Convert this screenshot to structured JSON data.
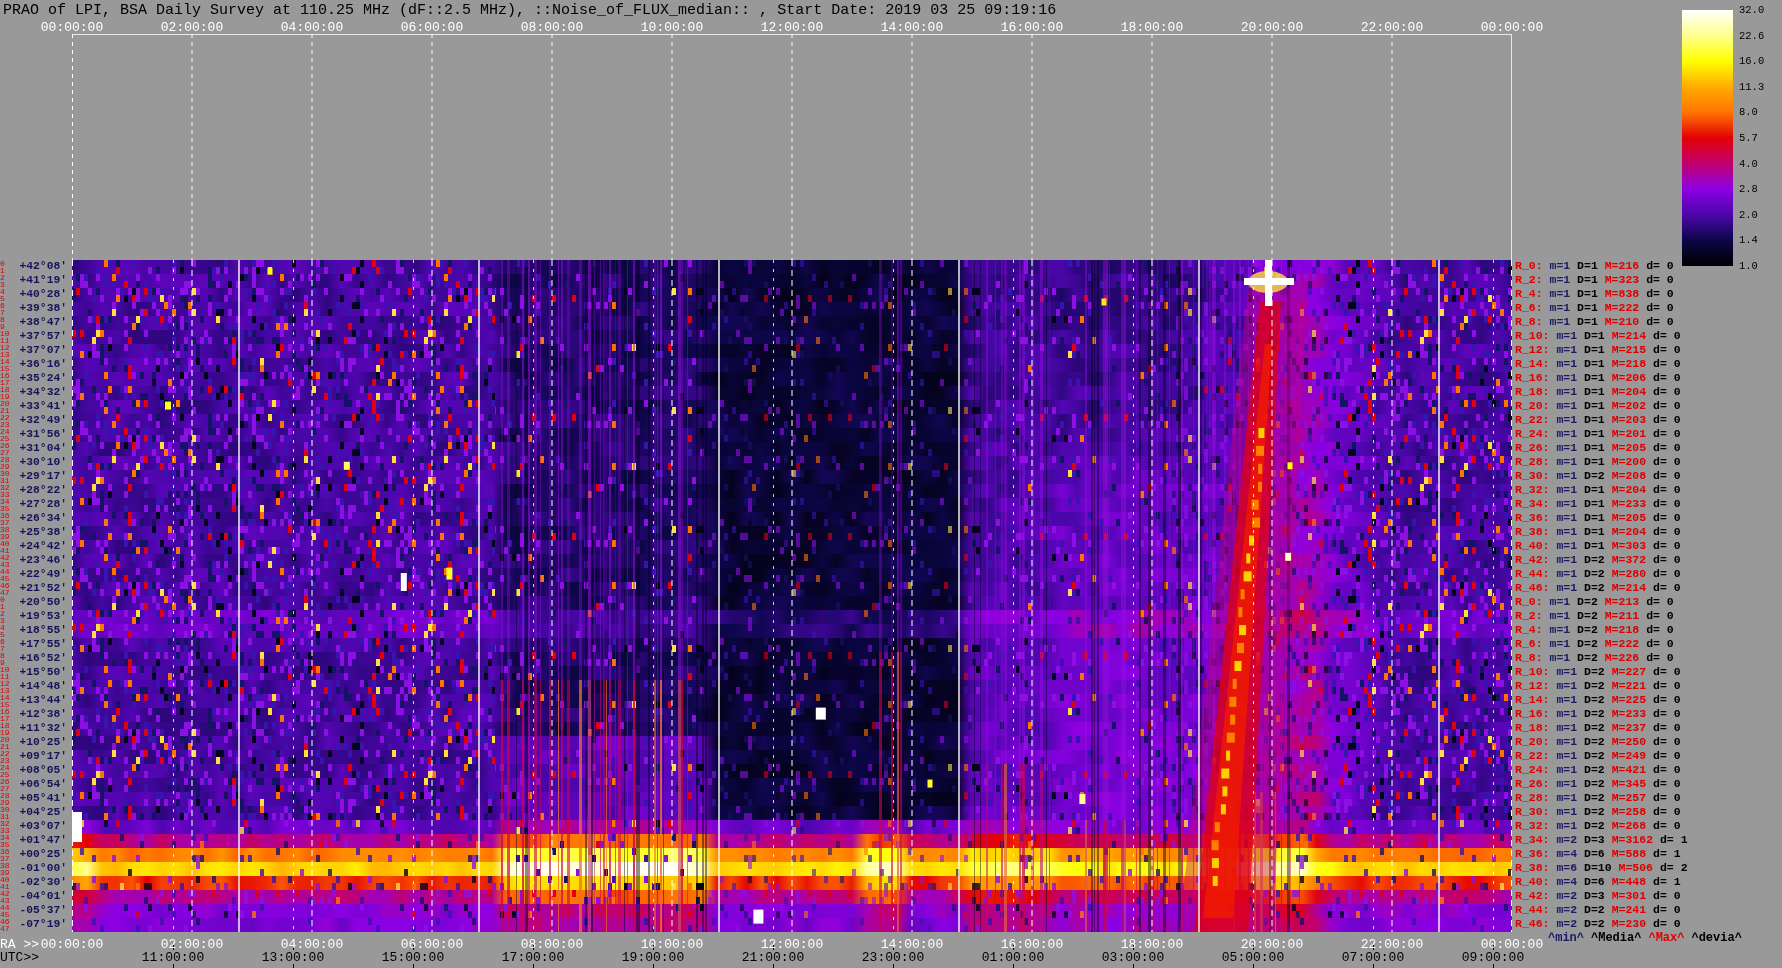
{
  "title": "PRAO of LPI, BSA Daily Survey at 110.25 MHz (dF::2.5 MHz), ::Noise_of_FLUX_median:: , Start Date: 2019 03 25 09:19:16",
  "top_axis": {
    "ticks": [
      "00:00:00",
      "02:00:00",
      "04:00:00",
      "06:00:00",
      "08:00:00",
      "10:00:00",
      "12:00:00",
      "14:00:00",
      "16:00:00",
      "18:00:00",
      "20:00:00",
      "22:00:00",
      "00:00:00"
    ]
  },
  "colorbar": {
    "ticks": [
      "32.0",
      "22.6",
      "16.0",
      "11.3",
      "8.0",
      "5.7",
      "4.0",
      "2.8",
      "2.0",
      "1.4",
      "1.0"
    ]
  },
  "rows": [
    {
      "numbers": [
        "0",
        "1"
      ],
      "declination": "+42°08'",
      "beam": "R_0:",
      "min": "m=1",
      "median": "D=1",
      "max": "M=216",
      "deviation": "d= 0"
    },
    {
      "numbers": [
        "2",
        "3"
      ],
      "declination": "+41°19'",
      "beam": "R_2:",
      "min": "m=1",
      "median": "D=1",
      "max": "M=323",
      "deviation": "d= 0"
    },
    {
      "numbers": [
        "4",
        "5"
      ],
      "declination": "+40°28'",
      "beam": "R_4:",
      "min": "m=1",
      "median": "D=1",
      "max": "M=838",
      "deviation": "d= 0"
    },
    {
      "numbers": [
        "6",
        "7"
      ],
      "declination": "+39°38'",
      "beam": "R_6:",
      "min": "m=1",
      "median": "D=1",
      "max": "M=222",
      "deviation": "d= 0"
    },
    {
      "numbers": [
        "8",
        "9"
      ],
      "declination": "+38°47'",
      "beam": "R_8:",
      "min": "m=1",
      "median": "D=1",
      "max": "M=210",
      "deviation": "d= 0"
    },
    {
      "numbers": [
        "10",
        "11"
      ],
      "declination": "+37°57'",
      "beam": "R_10:",
      "min": "m=1",
      "median": "D=1",
      "max": "M=214",
      "deviation": "d= 0"
    },
    {
      "numbers": [
        "12",
        "13"
      ],
      "declination": "+37°07'",
      "beam": "R_12:",
      "min": "m=1",
      "median": "D=1",
      "max": "M=215",
      "deviation": "d= 0"
    },
    {
      "numbers": [
        "14",
        "15"
      ],
      "declination": "+36°16'",
      "beam": "R_14:",
      "min": "m=1",
      "median": "D=1",
      "max": "M=218",
      "deviation": "d= 0"
    },
    {
      "numbers": [
        "16",
        "17"
      ],
      "declination": "+35°24'",
      "beam": "R_16:",
      "min": "m=1",
      "median": "D=1",
      "max": "M=206",
      "deviation": "d= 0"
    },
    {
      "numbers": [
        "18",
        "19"
      ],
      "declination": "+34°32'",
      "beam": "R_18:",
      "min": "m=1",
      "median": "D=1",
      "max": "M=204",
      "deviation": "d= 0"
    },
    {
      "numbers": [
        "20",
        "21"
      ],
      "declination": "+33°41'",
      "beam": "R_20:",
      "min": "m=1",
      "median": "D=1",
      "max": "M=202",
      "deviation": "d= 0"
    },
    {
      "numbers": [
        "22",
        "23"
      ],
      "declination": "+32°49'",
      "beam": "R_22:",
      "min": "m=1",
      "median": "D=1",
      "max": "M=203",
      "deviation": "d= 0"
    },
    {
      "numbers": [
        "24",
        "25"
      ],
      "declination": "+31°56'",
      "beam": "R_24:",
      "min": "m=1",
      "median": "D=1",
      "max": "M=201",
      "deviation": "d= 0"
    },
    {
      "numbers": [
        "26",
        "27"
      ],
      "declination": "+31°04'",
      "beam": "R_26:",
      "min": "m=1",
      "median": "D=1",
      "max": "M=205",
      "deviation": "d= 0"
    },
    {
      "numbers": [
        "28",
        "29"
      ],
      "declination": "+30°10'",
      "beam": "R_28:",
      "min": "m=1",
      "median": "D=1",
      "max": "M=200",
      "deviation": "d= 0"
    },
    {
      "numbers": [
        "30",
        "31"
      ],
      "declination": "+29°17'",
      "beam": "R_30:",
      "min": "m=1",
      "median": "D=2",
      "max": "M=208",
      "deviation": "d= 0"
    },
    {
      "numbers": [
        "32",
        "33"
      ],
      "declination": "+28°22'",
      "beam": "R_32:",
      "min": "m=1",
      "median": "D=1",
      "max": "M=204",
      "deviation": "d= 0"
    },
    {
      "numbers": [
        "34",
        "35"
      ],
      "declination": "+27°28'",
      "beam": "R_34:",
      "min": "m=1",
      "median": "D=1",
      "max": "M=233",
      "deviation": "d= 0"
    },
    {
      "numbers": [
        "36",
        "37"
      ],
      "declination": "+26°34'",
      "beam": "R_36:",
      "min": "m=1",
      "median": "D=1",
      "max": "M=205",
      "deviation": "d= 0"
    },
    {
      "numbers": [
        "38",
        "39"
      ],
      "declination": "+25°38'",
      "beam": "R_38:",
      "min": "m=1",
      "median": "D=1",
      "max": "M=204",
      "deviation": "d= 0"
    },
    {
      "numbers": [
        "40",
        "41"
      ],
      "declination": "+24°42'",
      "beam": "R_40:",
      "min": "m=1",
      "median": "D=1",
      "max": "M=303",
      "deviation": "d= 0"
    },
    {
      "numbers": [
        "42",
        "43"
      ],
      "declination": "+23°46'",
      "beam": "R_42:",
      "min": "m=1",
      "median": "D=2",
      "max": "M=372",
      "deviation": "d= 0"
    },
    {
      "numbers": [
        "44",
        "45"
      ],
      "declination": "+22°49'",
      "beam": "R_44:",
      "min": "m=1",
      "median": "D=2",
      "max": "M=280",
      "deviation": "d= 0"
    },
    {
      "numbers": [
        "46",
        "47"
      ],
      "declination": "+21°52'",
      "beam": "R_46:",
      "min": "m=1",
      "median": "D=2",
      "max": "M=214",
      "deviation": "d= 0"
    },
    {
      "numbers": [
        "0",
        "1"
      ],
      "declination": "+20°50'",
      "beam": "R_0:",
      "min": "m=1",
      "median": "D=2",
      "max": "M=213",
      "deviation": "d= 0"
    },
    {
      "numbers": [
        "2",
        "3"
      ],
      "declination": "+19°53'",
      "beam": "R_2:",
      "min": "m=1",
      "median": "D=2",
      "max": "M=211",
      "deviation": "d= 0"
    },
    {
      "numbers": [
        "4",
        "5"
      ],
      "declination": "+18°55'",
      "beam": "R_4:",
      "min": "m=1",
      "median": "D=2",
      "max": "M=218",
      "deviation": "d= 0"
    },
    {
      "numbers": [
        "6",
        "7"
      ],
      "declination": "+17°55'",
      "beam": "R_6:",
      "min": "m=1",
      "median": "D=2",
      "max": "M=222",
      "deviation": "d= 0"
    },
    {
      "numbers": [
        "8",
        "9"
      ],
      "declination": "+16°52'",
      "beam": "R_8:",
      "min": "m=1",
      "median": "D=2",
      "max": "M=226",
      "deviation": "d= 0"
    },
    {
      "numbers": [
        "10",
        "11"
      ],
      "declination": "+15°50'",
      "beam": "R_10:",
      "min": "m=1",
      "median": "D=2",
      "max": "M=227",
      "deviation": "d= 0"
    },
    {
      "numbers": [
        "12",
        "13"
      ],
      "declination": "+14°48'",
      "beam": "R_12:",
      "min": "m=1",
      "median": "D=2",
      "max": "M=221",
      "deviation": "d= 0"
    },
    {
      "numbers": [
        "14",
        "15"
      ],
      "declination": "+13°44'",
      "beam": "R_14:",
      "min": "m=1",
      "median": "D=2",
      "max": "M=225",
      "deviation": "d= 0"
    },
    {
      "numbers": [
        "16",
        "17"
      ],
      "declination": "+12°38'",
      "beam": "R_16:",
      "min": "m=1",
      "median": "D=2",
      "max": "M=233",
      "deviation": "d= 0"
    },
    {
      "numbers": [
        "18",
        "19"
      ],
      "declination": "+11°32'",
      "beam": "R_18:",
      "min": "m=1",
      "median": "D=2",
      "max": "M=237",
      "deviation": "d= 0"
    },
    {
      "numbers": [
        "20",
        "21"
      ],
      "declination": "+10°25'",
      "beam": "R_20:",
      "min": "m=1",
      "median": "D=2",
      "max": "M=250",
      "deviation": "d= 0"
    },
    {
      "numbers": [
        "22",
        "23"
      ],
      "declination": "+09°17'",
      "beam": "R_22:",
      "min": "m=1",
      "median": "D=2",
      "max": "M=249",
      "deviation": "d= 0"
    },
    {
      "numbers": [
        "24",
        "25"
      ],
      "declination": "+08°05'",
      "beam": "R_24:",
      "min": "m=1",
      "median": "D=2",
      "max": "M=421",
      "deviation": "d= 0"
    },
    {
      "numbers": [
        "26",
        "27"
      ],
      "declination": "+06°54'",
      "beam": "R_26:",
      "min": "m=1",
      "median": "D=2",
      "max": "M=345",
      "deviation": "d= 0"
    },
    {
      "numbers": [
        "28",
        "29"
      ],
      "declination": "+05°41'",
      "beam": "R_28:",
      "min": "m=1",
      "median": "D=2",
      "max": "M=257",
      "deviation": "d= 0"
    },
    {
      "numbers": [
        "30",
        "31"
      ],
      "declination": "+04°25'",
      "beam": "R_30:",
      "min": "m=1",
      "median": "D=2",
      "max": "M=258",
      "deviation": "d= 0"
    },
    {
      "numbers": [
        "32",
        "33"
      ],
      "declination": "+03°07'",
      "beam": "R_32:",
      "min": "m=1",
      "median": "D=2",
      "max": "M=268",
      "deviation": "d= 0"
    },
    {
      "numbers": [
        "34",
        "35"
      ],
      "declination": "+01°47'",
      "beam": "R_34:",
      "min": "m=2",
      "median": "D=3",
      "max": "M=3162",
      "deviation": "d= 1"
    },
    {
      "numbers": [
        "36",
        "37"
      ],
      "declination": "+00°25'",
      "beam": "R_36:",
      "min": "m=4",
      "median": "D=6",
      "max": "M=588",
      "deviation": "d= 1"
    },
    {
      "numbers": [
        "38",
        "39"
      ],
      "declination": "-01°00'",
      "beam": "R_38:",
      "min": "m=6",
      "median": "D=10",
      "max": "M=506",
      "deviation": "d= 2"
    },
    {
      "numbers": [
        "40",
        "41"
      ],
      "declination": "-02°30'",
      "beam": "R_40:",
      "min": "m=4",
      "median": "D=6",
      "max": "M=448",
      "deviation": "d= 1"
    },
    {
      "numbers": [
        "42",
        "43"
      ],
      "declination": "-04°01'",
      "beam": "R_42:",
      "min": "m=2",
      "median": "D=3",
      "max": "M=301",
      "deviation": "d= 0"
    },
    {
      "numbers": [
        "44",
        "45"
      ],
      "declination": "-05°37'",
      "beam": "R_44:",
      "min": "m=2",
      "median": "D=2",
      "max": "M=241",
      "deviation": "d= 0"
    },
    {
      "numbers": [
        "46",
        "47"
      ],
      "declination": "-07°19'",
      "beam": "R_46:",
      "min": "m=2",
      "median": "D=2",
      "max": "M=230",
      "deviation": "d= 0"
    }
  ],
  "bottom_axis": {
    "ra_label": "RA >>",
    "ra_ticks": [
      "00:00:00",
      "02:00:00",
      "04:00:00",
      "06:00:00",
      "08:00:00",
      "10:00:00",
      "12:00:00",
      "14:00:00",
      "16:00:00",
      "18:00:00",
      "20:00:00",
      "22:00:00",
      "00:00:00"
    ],
    "utc_label": "UTC>>",
    "utc_ticks": [
      "11:00:00",
      "13:00:00",
      "15:00:00",
      "17:00:00",
      "19:00:00",
      "21:00:00",
      "23:00:00",
      "01:00:00",
      "03:00:00",
      "05:00:00",
      "07:00:00",
      "09:00:00"
    ]
  },
  "legend": {
    "min": "^min^",
    "median": "^Media^",
    "max": "^Max^",
    "deviation": "^devia^"
  }
}
